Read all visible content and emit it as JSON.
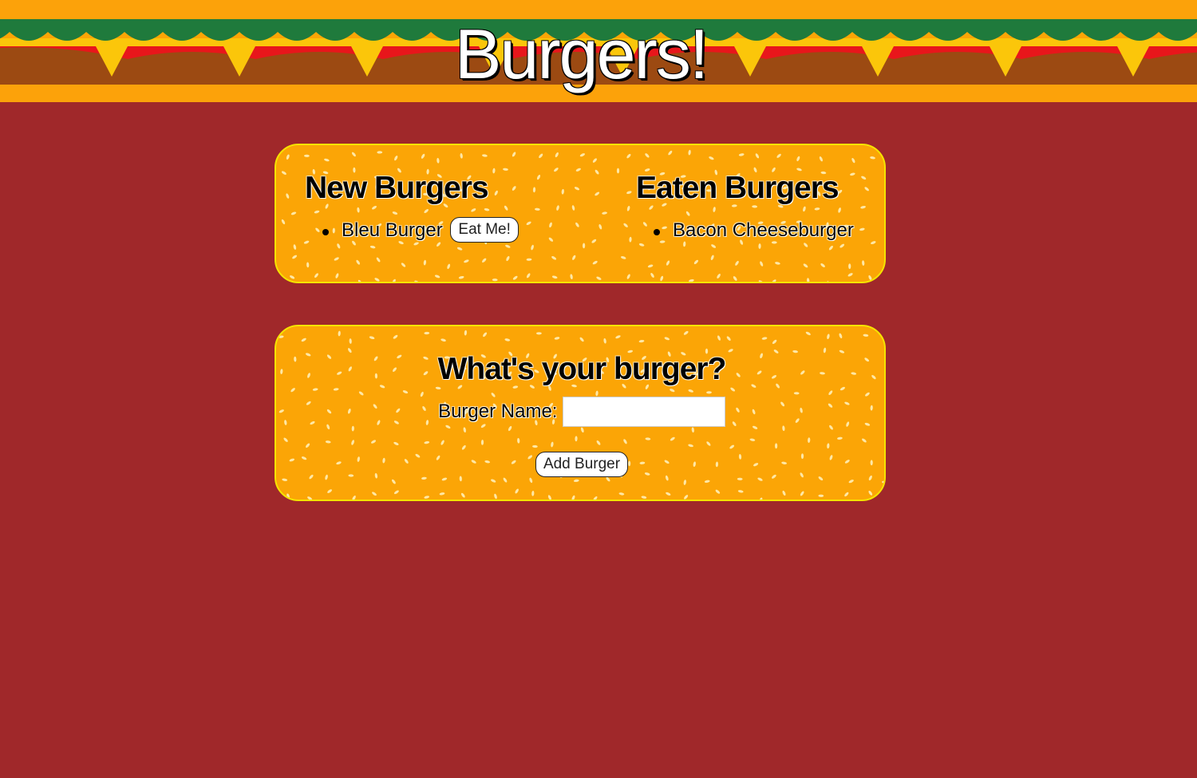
{
  "header": {
    "title": "Burgers!",
    "colors": {
      "bun": "#fba506",
      "lettuce": "#1f7a3c",
      "tomato": "#e8161b",
      "cheese": "#fbc60a",
      "patty": "#9c4a12"
    }
  },
  "new_burgers": {
    "title": "New Burgers",
    "items": [
      {
        "name": "Bleu Burger",
        "action_label": "Eat Me!"
      }
    ]
  },
  "eaten_burgers": {
    "title": "Eaten Burgers",
    "items": [
      {
        "name": "Bacon Cheeseburger"
      }
    ]
  },
  "form": {
    "title": "What's your burger?",
    "name_label": "Burger Name:",
    "name_value": "",
    "name_placeholder": "",
    "submit_label": "Add Burger"
  },
  "theme": {
    "page_background": "#a0282a",
    "panel_background": "#fba506",
    "panel_border": "#f5e400",
    "seed_color": "#fff3c2"
  }
}
